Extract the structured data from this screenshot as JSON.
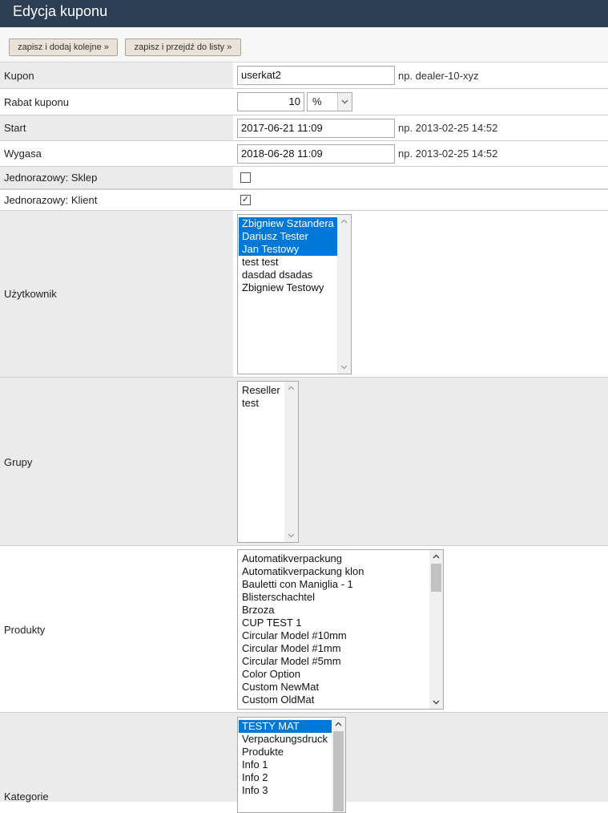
{
  "page": {
    "title": "Edycja kuponu"
  },
  "toolbar": {
    "save_add_label": "zapisz i dodaj kolejne »",
    "save_list_label": "zapisz i przejdź do listy »"
  },
  "fields": {
    "kupon": {
      "label": "Kupon",
      "value": "userkat2",
      "hint": "np. dealer-10-xyz"
    },
    "rabat": {
      "label": "Rabat kuponu",
      "value": "10",
      "unit": "%"
    },
    "start": {
      "label": "Start",
      "value": "2017-06-21 11:09",
      "hint": "np. 2013-02-25 14:52"
    },
    "wygasa": {
      "label": "Wygasa",
      "value": "2018-06-28 11:09",
      "hint": "np. 2013-02-25 14:52"
    },
    "sklep": {
      "label": "Jednorazowy: Sklep",
      "checked": false,
      "mark": ""
    },
    "klient": {
      "label": "Jednorazowy: Klient",
      "checked": true,
      "mark": "✓"
    },
    "uzytkownik": {
      "label": "Użytkownik",
      "options": [
        "Zbigniew Sztandera",
        "Dariusz Tester",
        "Jan Testowy",
        "test test",
        "dasdad dsadas",
        "Zbigniew Testowy"
      ],
      "selected": [
        true,
        true,
        true,
        false,
        false,
        false
      ]
    },
    "grupy": {
      "label": "Grupy",
      "options": [
        "Reseller",
        "test"
      ]
    },
    "produkty": {
      "label": "Produkty",
      "options": [
        "Automatikverpackung",
        "Automatikverpackung klon",
        "Bauletti con Maniglia - 1",
        "Blisterschachtel",
        "Brzoza",
        "CUP TEST 1",
        "Circular Model #10mm",
        "Circular Model #1mm",
        "Circular Model #5mm",
        "Color Option",
        "Custom NewMat",
        "Custom OldMat"
      ]
    },
    "kategorie": {
      "label": "Kategorie",
      "options": [
        "TESTY MAT",
        "Verpackungsdruck",
        "Produkte",
        "Info 1",
        "Info 2",
        "Info 3"
      ],
      "selected": [
        true,
        false,
        false,
        false,
        false,
        false
      ]
    }
  },
  "icons": {
    "scroll_up": "chevron-up-icon",
    "scroll_down": "chevron-down-icon",
    "dropdown": "chevron-down-icon",
    "check": "checkmark-icon"
  },
  "colors": {
    "header_bg": "#2c3e54",
    "selection": "#0078d7",
    "row_gray": "#ebebeb"
  }
}
